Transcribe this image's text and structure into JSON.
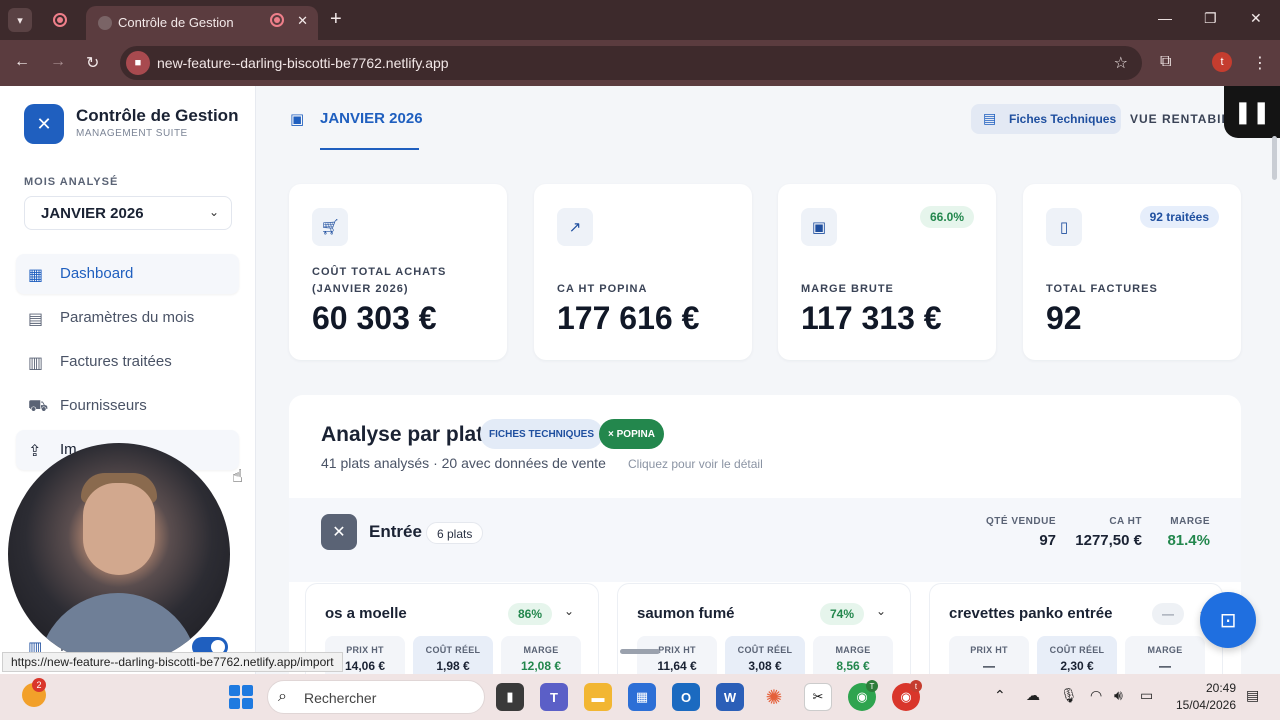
{
  "browser": {
    "tab_title": "Contrôle de Gestion",
    "url": "new-feature--darling-biscotti-be7762.netlify.app",
    "profile_initial": "t",
    "status_url": "https://new-feature--darling-biscotti-be7762.netlify.app/import"
  },
  "sidebar": {
    "app_title": "Contrôle de Gestion",
    "app_subtitle": "MANAGEMENT SUITE",
    "month_label": "MOIS ANALYSÉ",
    "month_value": "JANVIER 2026",
    "items": [
      {
        "label": "Dashboard",
        "icon": "dashboard-icon"
      },
      {
        "label": "Paramètres du mois",
        "icon": "calendar-icon"
      },
      {
        "label": "Factures traitées",
        "icon": "invoice-icon"
      },
      {
        "label": "Fournisseurs",
        "icon": "truck-icon"
      },
      {
        "label": "Im",
        "icon": "import-icon"
      }
    ],
    "bottom_label": "F"
  },
  "header": {
    "month_tab": "JANVIER 2026",
    "fiches_button": "Fiches Techniques",
    "vue_label": "VUE RENTABILITÉ"
  },
  "kpis": [
    {
      "label": "COÛT TOTAL ACHATS (JANVIER 2026)",
      "value": "60 303 €",
      "icon": "cart-icon",
      "badge": ""
    },
    {
      "label": "CA HT POPINA",
      "value": "177 616 €",
      "icon": "trend-up-icon",
      "badge": ""
    },
    {
      "label": "MARGE BRUTE",
      "value": "117 313 €",
      "icon": "wallet-icon",
      "badge": "66.0%"
    },
    {
      "label": "TOTAL FACTURES",
      "value": "92",
      "icon": "document-icon",
      "badge": "92 traitées"
    }
  ],
  "analysis": {
    "title": "Analyse par plat",
    "pill_fiches": "FICHES TECHNIQUES",
    "pill_popina": "× POPINA",
    "subtitle": "41 plats analysés · 20 avec données de vente",
    "hint": "Cliquez pour voir le détail",
    "section": {
      "title": "Entrée",
      "count": "6 plats",
      "stats": [
        {
          "label": "QTÉ VENDUE",
          "value": "97"
        },
        {
          "label": "CA HT",
          "value": "1277,50 €"
        },
        {
          "label": "MARGE",
          "value": "81.4%"
        }
      ]
    },
    "metric_labels": {
      "prix": "PRIX HT",
      "cout": "COÛT RÉEL",
      "marge": "MARGE"
    },
    "dishes": [
      {
        "name": "os a moelle",
        "badge": "86%",
        "prix": "14,06 €",
        "cout": "1,98 €",
        "marge": "12,08 €"
      },
      {
        "name": "saumon fumé",
        "badge": "74%",
        "prix": "11,64 €",
        "cout": "3,08 €",
        "marge": "8,56 €"
      },
      {
        "name": "crevettes panko entrée",
        "badge": "—",
        "prix": "—",
        "cout": "2,30 €",
        "marge": "—"
      }
    ]
  },
  "taskbar": {
    "search_placeholder": "Rechercher",
    "time": "20:49",
    "date": "15/04/2026",
    "weather_badge": "2",
    "chrome_badge_1": "T",
    "chrome_badge_2": "t"
  },
  "colors": {
    "accent": "#1f5fbf",
    "positive": "#23874d",
    "fab": "#1f6fe0"
  }
}
